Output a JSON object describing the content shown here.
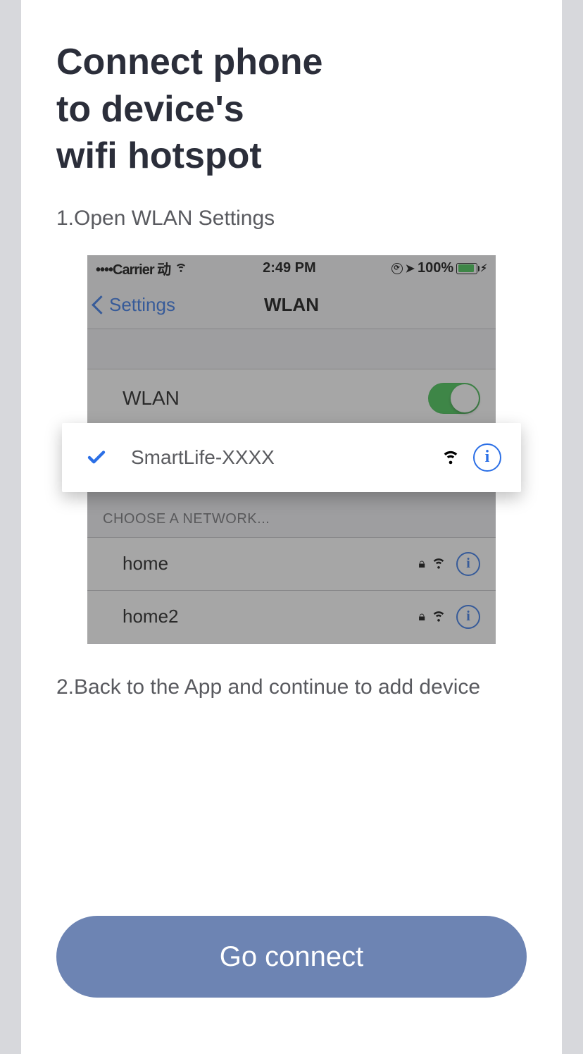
{
  "title_line1": "Connect phone",
  "title_line2": "to device's",
  "title_line3": "wifi hotspot",
  "step1": "1.Open WLAN Settings",
  "step2": "2.Back to the App and continue to add device",
  "mock": {
    "status": {
      "carrier": "••••Carrier 动",
      "time": "2:49 PM",
      "battery": "100%"
    },
    "nav": {
      "back": "Settings",
      "title": "WLAN"
    },
    "wlan_toggle_label": "WLAN",
    "selected_network": "SmartLife-XXXX",
    "section_label": "CHOOSE A NETWORK...",
    "networks": [
      {
        "name": "home"
      },
      {
        "name": "home2"
      }
    ]
  },
  "button": "Go connect"
}
